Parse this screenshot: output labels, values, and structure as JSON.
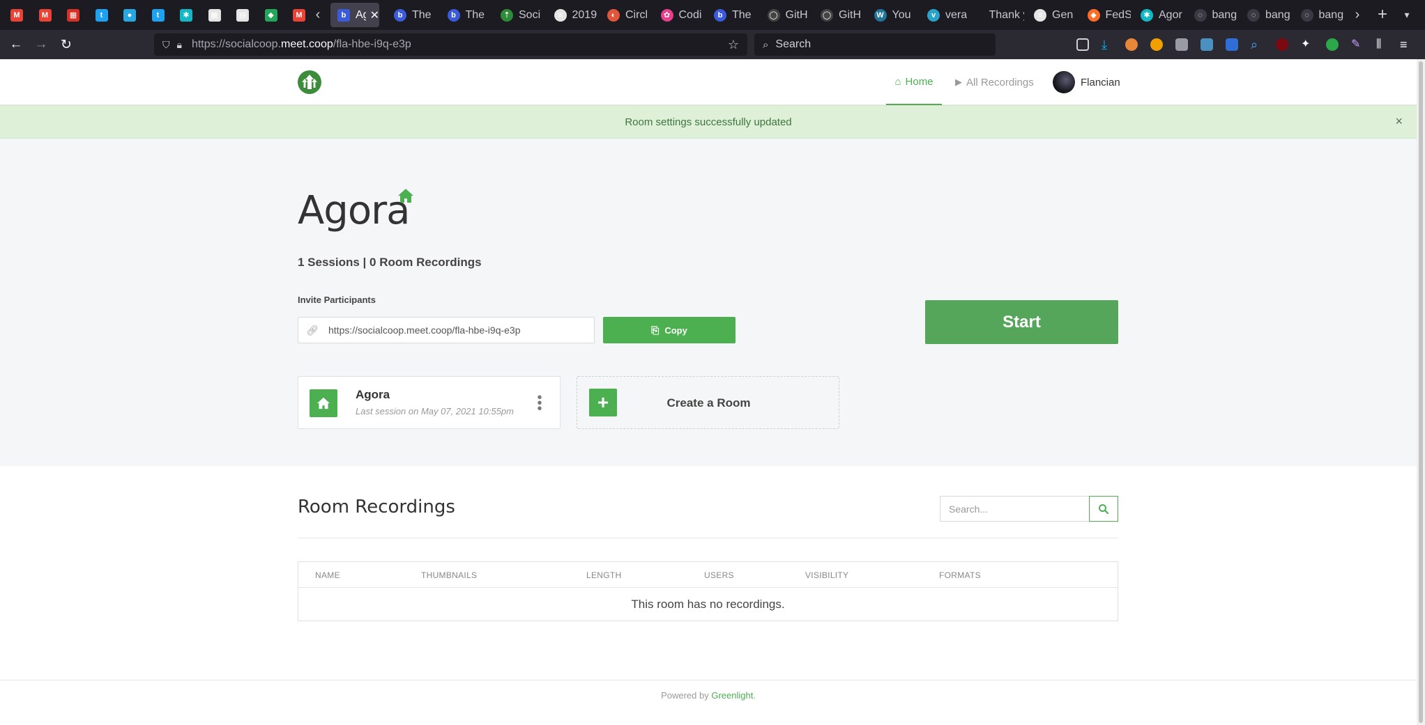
{
  "browser": {
    "tabs": [
      {
        "label": "",
        "color": "#ea4335",
        "icon": "gmail-icon"
      },
      {
        "label": "",
        "color": "#ea4335",
        "icon": "gmail-icon"
      },
      {
        "label": "",
        "color": "#d93025",
        "icon": "calendar-icon"
      },
      {
        "label": "",
        "color": "#1da1f2",
        "icon": "twitter-icon"
      },
      {
        "label": "",
        "color": "#28a8e0",
        "icon": "signal-icon"
      },
      {
        "label": "",
        "color": "#1da1f2",
        "icon": "twitter-icon"
      },
      {
        "label": "",
        "color": "#14b8c4",
        "icon": "element-icon"
      },
      {
        "label": "",
        "color": "#e5e5e5",
        "icon": "calendar-icon"
      },
      {
        "label": "",
        "color": "#e5e5e5",
        "icon": "book-icon"
      },
      {
        "label": "",
        "color": "#23a55a",
        "icon": "app-icon"
      },
      {
        "label": "",
        "color": "#ea4335",
        "icon": "gmail-icon"
      }
    ],
    "active_tab": {
      "label": "Ag",
      "icon": "bigbluebutton-icon"
    },
    "more_tabs": [
      {
        "label": "The",
        "icon": "bigbluebutton-icon"
      },
      {
        "label": "The",
        "icon": "bigbluebutton-icon"
      },
      {
        "label": "Soci",
        "icon": "socialcoop-icon"
      },
      {
        "label": "2019",
        "icon": "document-icon"
      },
      {
        "label": "Circl",
        "icon": "circle-icon"
      },
      {
        "label": "Codi",
        "icon": "paw-icon"
      },
      {
        "label": "The",
        "icon": "bigbluebutton-icon"
      },
      {
        "label": "GitH",
        "icon": "github-icon"
      },
      {
        "label": "GitH",
        "icon": "github-icon"
      },
      {
        "label": "You",
        "icon": "wordpress-icon"
      },
      {
        "label": "vera",
        "icon": "vera-icon"
      },
      {
        "label": "Thank y",
        "icon": ""
      },
      {
        "label": "Gen",
        "icon": "document-icon"
      },
      {
        "label": "FedS",
        "icon": "gitlab-icon"
      },
      {
        "label": "Agor",
        "icon": "element-icon"
      },
      {
        "label": "bang",
        "icon": "loading-icon"
      },
      {
        "label": "bang",
        "icon": "loading-icon"
      },
      {
        "label": "bang",
        "icon": "loading-icon"
      }
    ],
    "url_prefix": "https://socialcoop.",
    "url_domain": "meet.coop",
    "url_path": "/fla-hbe-i9q-e3p",
    "search_placeholder": "Search"
  },
  "header": {
    "nav_home": "Home",
    "nav_recordings": "All Recordings",
    "user_name": "Flancian"
  },
  "flash": {
    "message": "Room settings successfully updated",
    "close": "×"
  },
  "room": {
    "title": "Agora",
    "stats": "1 Sessions | 0 Room Recordings",
    "invite_label": "Invite Participants",
    "invite_url": "https://socialcoop.meet.coop/fla-hbe-i9q-e3p",
    "copy_label": "Copy",
    "start_label": "Start",
    "card_name": "Agora",
    "card_subtitle": "Last session on May 07, 2021 10:55pm",
    "create_label": "Create a Room"
  },
  "recordings": {
    "title": "Room Recordings",
    "search_placeholder": "Search...",
    "columns": [
      "Name",
      "Thumbnails",
      "Length",
      "Users",
      "Visibility",
      "Formats"
    ],
    "empty_message": "This room has no recordings."
  },
  "footer": {
    "prefix": "Powered by ",
    "link": "Greenlight",
    "suffix": "."
  },
  "colors": {
    "accent": "#4caf50",
    "flash_bg": "#dff0d8",
    "flash_text": "#3c763d"
  }
}
